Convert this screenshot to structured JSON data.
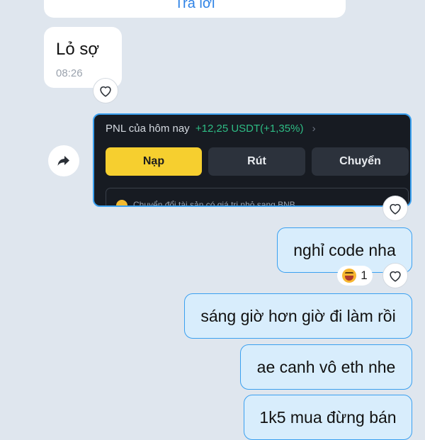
{
  "top_bubble": {
    "reply_label": "Trả lời"
  },
  "incoming": {
    "text": "Lỏ sợ",
    "time": "08:26"
  },
  "shared_card": {
    "pnl_label": "PNL của hôm nay",
    "pnl_value": "+12,25 USDT(+1,35%)",
    "pnl_chevron": "›",
    "buttons": {
      "deposit": "Nạp",
      "withdraw": "Rút",
      "transfer": "Chuyển"
    },
    "notice": "Chuyển đổi tài sản có giá trị nhỏ sang BNB"
  },
  "outgoing": [
    {
      "text": "nghỉ code nha"
    },
    {
      "text": "sáng giờ hơn giờ đi làm rồi"
    },
    {
      "text": "ae canh vô eth nhe"
    },
    {
      "text": "1k5 mua đừng bán"
    }
  ],
  "reaction": {
    "emoji": "laughing-face",
    "count": "1"
  },
  "colors": {
    "background": "#dfe6ee",
    "bubble_out": "#d8edfc",
    "bubble_border": "#3aa0f0",
    "accent_yellow": "#f6cf2f",
    "pnl_green": "#2ebd85",
    "link_blue": "#2f83e6"
  }
}
